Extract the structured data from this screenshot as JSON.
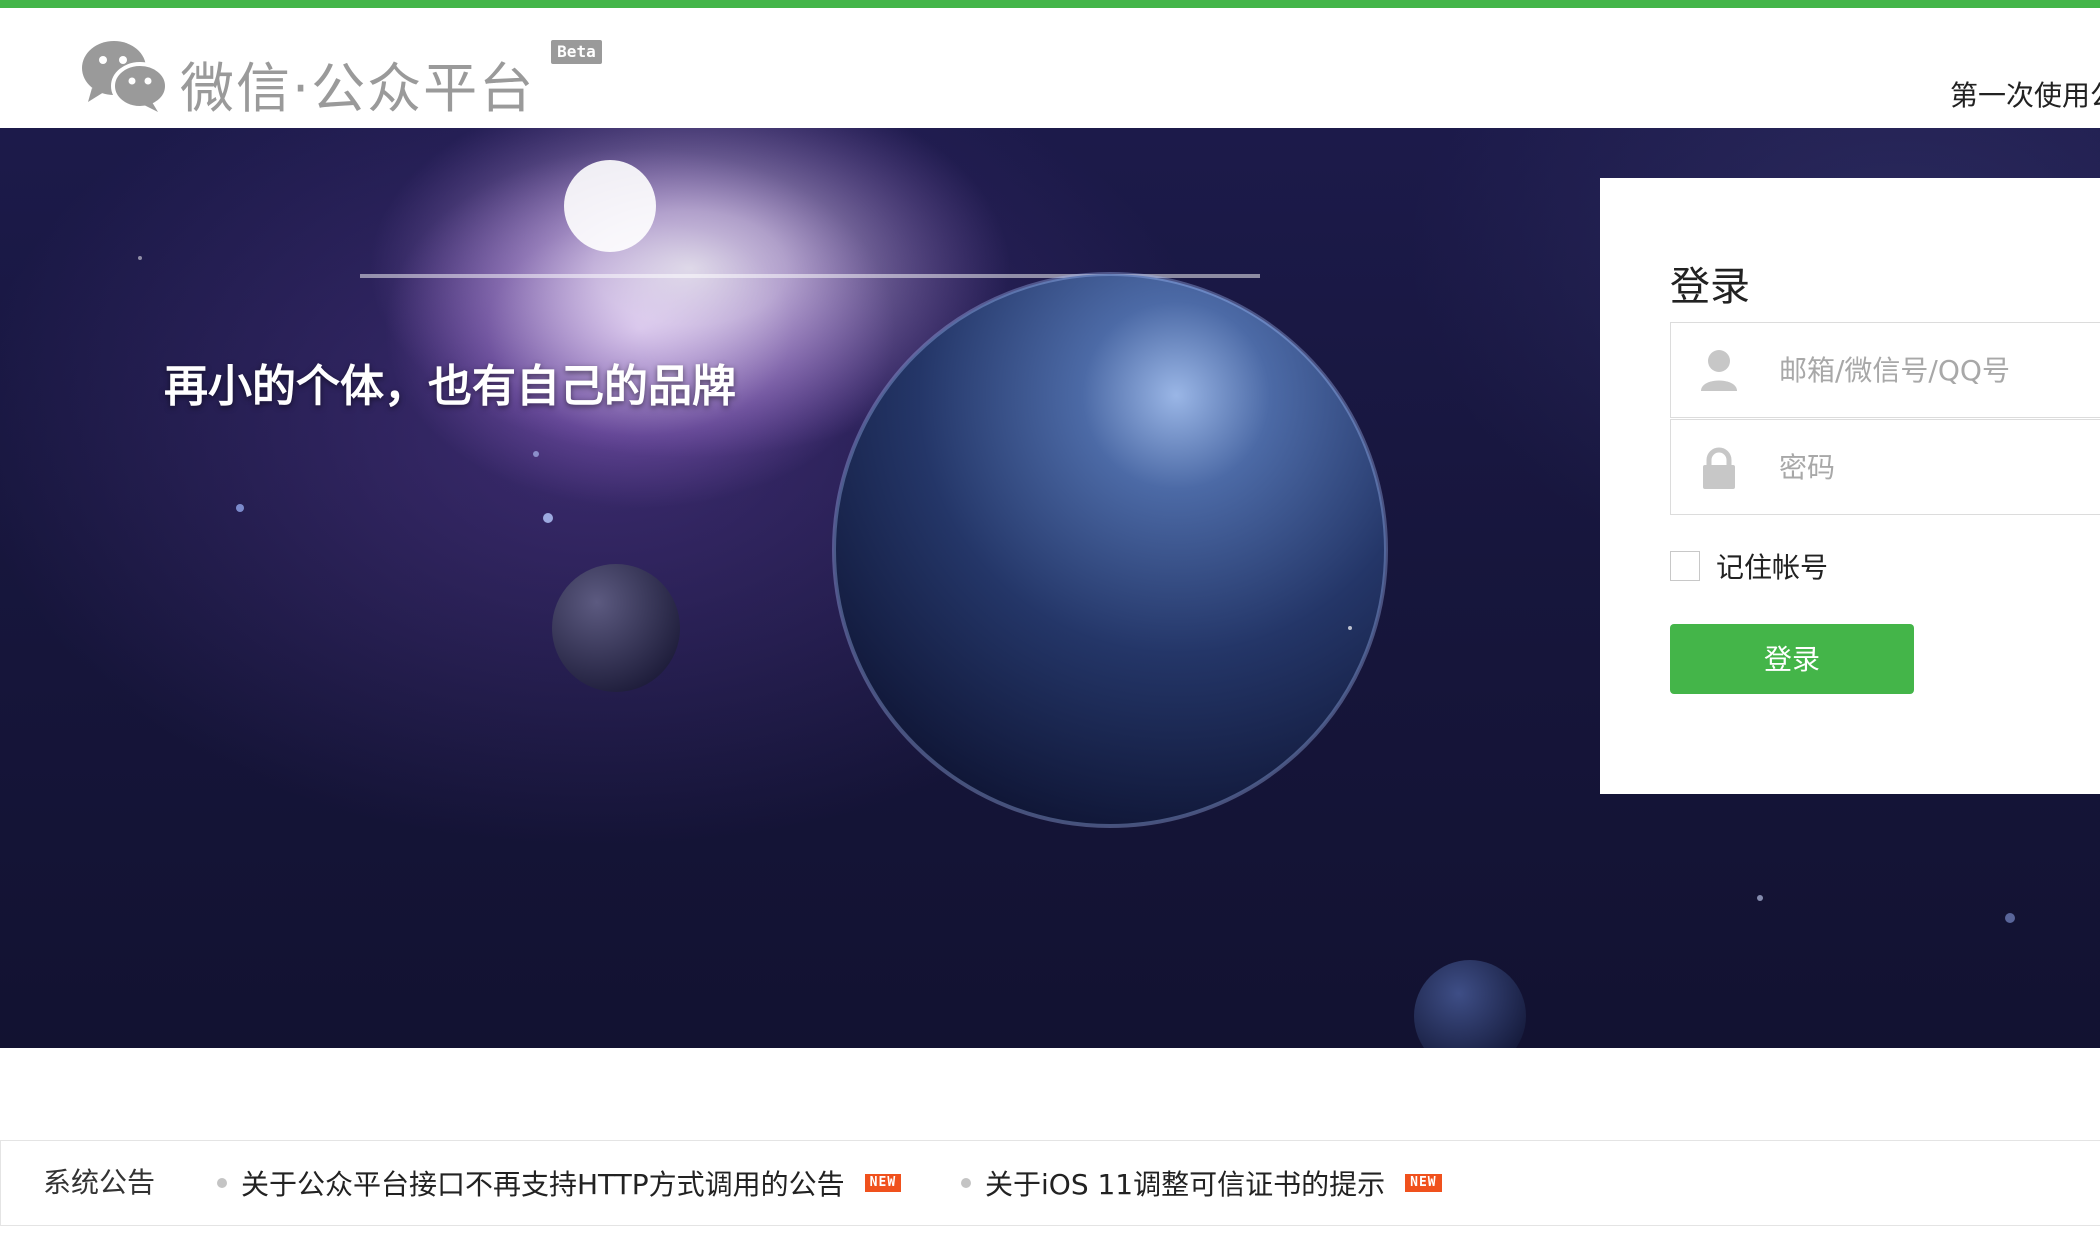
{
  "header": {
    "logo_text": "微信·公众平台",
    "logo_icon": "wechat-bubbles-icon",
    "beta_badge": "Beta",
    "first_use_text": "第一次使用公"
  },
  "banner": {
    "tagline": "再小的个体，也有自己的品牌"
  },
  "login": {
    "title": "登录",
    "account_placeholder": "邮箱/微信号/QQ号",
    "account_value": "",
    "account_icon": "user-icon",
    "password_placeholder": "密码",
    "password_value": "",
    "password_icon": "lock-icon",
    "remember_label": "记住帐号",
    "remember_checked": false,
    "submit_label": "登录"
  },
  "notices": {
    "label": "系统公告",
    "items": [
      {
        "text": "关于公众平台接口不再支持HTTP方式调用的公告",
        "badge": "NEW"
      },
      {
        "text": "关于iOS 11调整可信证书的提示",
        "badge": "NEW"
      }
    ]
  },
  "colors": {
    "accent_green": "#44b549",
    "badge_orange": "#f0511d",
    "logo_gray": "#9a9a9a",
    "banner_dark": "#17163d"
  }
}
